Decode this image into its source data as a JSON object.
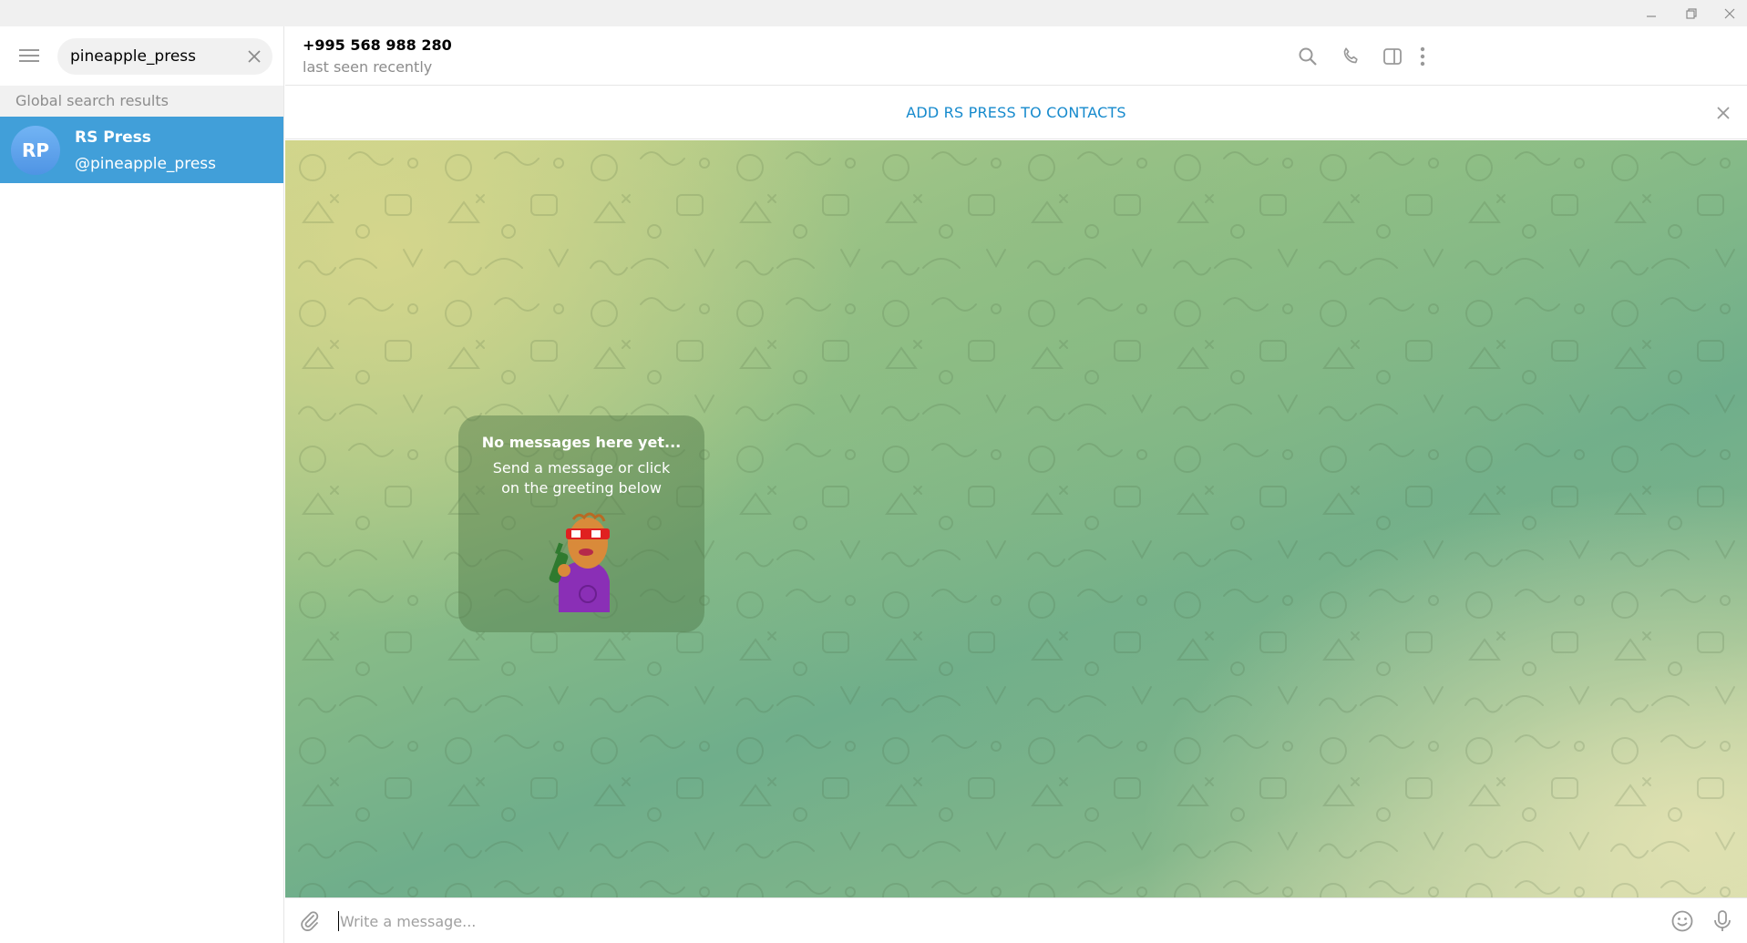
{
  "window": {
    "controls": [
      "minimize-icon",
      "restore-icon",
      "close-icon"
    ]
  },
  "sidebar": {
    "search": {
      "value": "pineapple_press"
    },
    "section_label": "Global search results",
    "results": [
      {
        "initials": "RP",
        "name": "RS Press",
        "handle": "@pineapple_press",
        "avatar_color": "#5ba4ec"
      }
    ],
    "selected_color": "#419fd9"
  },
  "chat": {
    "title": "+995 568 988 280",
    "status": "last seen recently",
    "header_icons": [
      "search-icon",
      "phone-icon",
      "sidebar-toggle-icon",
      "more-vertical-icon"
    ],
    "add_contact_label": "ADD RS PRESS TO CONTACTS",
    "accent_color": "#168acd",
    "empty_state": {
      "title": "No messages here yet...",
      "subtitle": "Send a message or click on the greeting below"
    },
    "compose": {
      "placeholder": "Write a message..."
    }
  }
}
